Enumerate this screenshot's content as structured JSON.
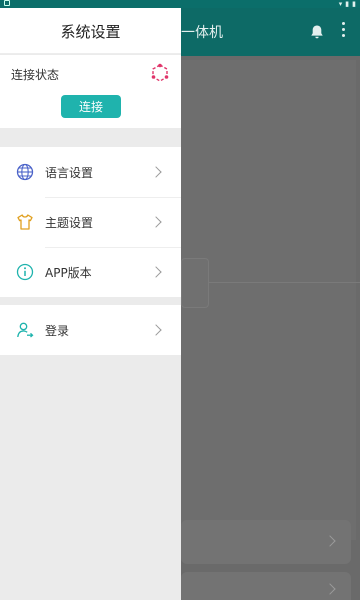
{
  "status_bar": {
    "left_icon": "android-icon",
    "right_icons": [
      "wifi-icon",
      "signal-icon",
      "battery-icon"
    ]
  },
  "background": {
    "title": "一体机",
    "icons": [
      "bell-icon",
      "more-vert-icon"
    ]
  },
  "drawer": {
    "title": "系统设置",
    "connection": {
      "label": "连接状态",
      "icon": "hexagon-link-icon",
      "button_label": "连接"
    },
    "menu": [
      {
        "label": "语言设置",
        "icon": "globe-icon"
      },
      {
        "label": "主题设置",
        "icon": "tshirt-icon"
      },
      {
        "label": "APP版本",
        "icon": "info-icon"
      }
    ],
    "login": {
      "label": "登录",
      "icon": "user-login-icon"
    }
  },
  "colors": {
    "accent": "#1fb3ad",
    "appbar": "#0d6a66",
    "globe_icon": "#4b63c9",
    "tshirt_icon": "#e0a020",
    "info_icon": "#1fb3ad",
    "conn_icon": "#e0356a"
  }
}
